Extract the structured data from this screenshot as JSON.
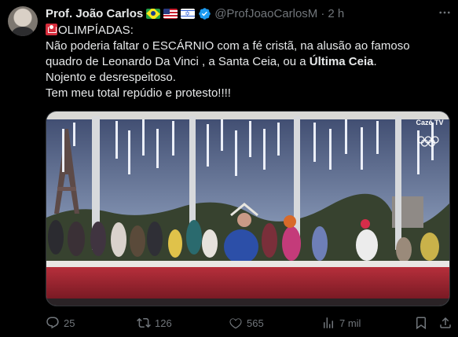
{
  "author": {
    "name": "Prof. João Carlos",
    "handle": "@ProfJoaoCarlosM",
    "separator": "·",
    "time": "2 h",
    "flags": [
      "brazil-flag",
      "usa-flag",
      "israel-flag"
    ]
  },
  "post": {
    "line1_label": "OLIMPÍADAS:",
    "line2": "Não poderia faltar o ESCÁRNIO com a fé cristã, na alusão ao famoso",
    "line3_pre": "quadro de Leonardo Da Vinci , a Santa Ceia, ou a ",
    "line3_bold": "Última Ceia",
    "line3_post": ".",
    "line4": "Nojento e desrespeitoso.",
    "line5": "Tem meu total repúdio e protesto!!!!"
  },
  "media": {
    "watermark": "Cazé TV"
  },
  "actions": {
    "replies": "25",
    "reposts": "126",
    "likes": "565",
    "views": "7 mil"
  },
  "colors": {
    "background": "#000000",
    "text": "#e7e9ea",
    "secondary": "#71767b",
    "verified": "#1d9bf0"
  }
}
